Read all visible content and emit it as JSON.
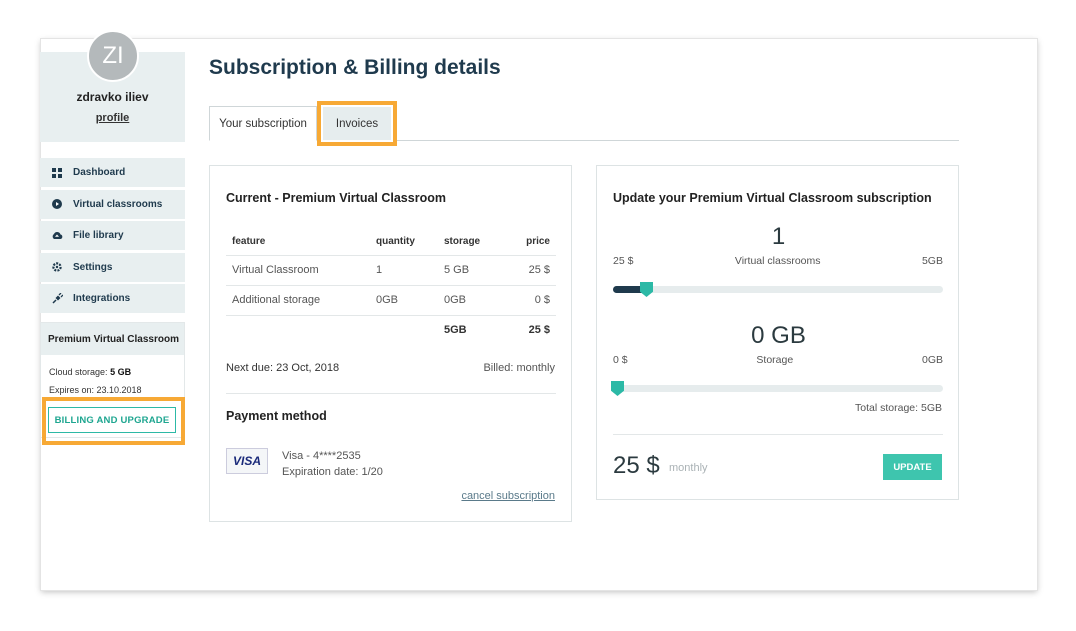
{
  "user": {
    "initials": "ZI",
    "name": "zdravko iliev",
    "profile_link": "profile"
  },
  "sidebar": {
    "items": [
      {
        "label": "Dashboard",
        "icon": "grid-icon"
      },
      {
        "label": "Virtual classrooms",
        "icon": "play-circle-icon"
      },
      {
        "label": "File library",
        "icon": "cloud-upload-icon"
      },
      {
        "label": "Settings",
        "icon": "gear-icon"
      },
      {
        "label": "Integrations",
        "icon": "plug-icon"
      }
    ],
    "plan": {
      "title": "Premium Virtual Classroom",
      "storage_label": "Cloud storage:",
      "storage_value": "5 GB",
      "expires": "Expires on: 23.10.2018",
      "billing_button": "BILLING AND UPGRADE"
    }
  },
  "main": {
    "title": "Subscription & Billing details",
    "tabs": [
      {
        "label": "Your subscription"
      },
      {
        "label": "Invoices"
      }
    ]
  },
  "current": {
    "title": "Current - Premium Virtual Classroom",
    "columns": [
      "feature",
      "quantity",
      "storage",
      "price"
    ],
    "rows": [
      [
        "Virtual Classroom",
        "1",
        "5 GB",
        "25 $"
      ],
      [
        "Additional storage",
        "0GB",
        "0GB",
        "0 $"
      ]
    ],
    "total_storage": "5GB",
    "total_price": "25 $",
    "next_due": "Next due: 23 Oct, 2018",
    "billed": "Billed: monthly",
    "payment_title": "Payment method",
    "card_brand": "VISA",
    "card_number": "Visa - 4****2535",
    "card_expiration": "Expiration date: 1/20",
    "cancel_link": "cancel subscription"
  },
  "update": {
    "title": "Update your Premium Virtual Classroom subscription",
    "classrooms": {
      "value": "1",
      "min": "25 $",
      "label": "Virtual classrooms",
      "max": "5GB",
      "level": 0.1
    },
    "storage": {
      "value": "0 GB",
      "min": "0 $",
      "label": "Storage",
      "max": "0GB",
      "level": 0
    },
    "total_storage": "Total storage: 5GB",
    "price": "25 $",
    "period": "monthly",
    "update_button": "UPDATE"
  },
  "colors": {
    "accent": "#2cb9a6",
    "navy": "#1f3a4d",
    "highlight": "#f7a935"
  }
}
